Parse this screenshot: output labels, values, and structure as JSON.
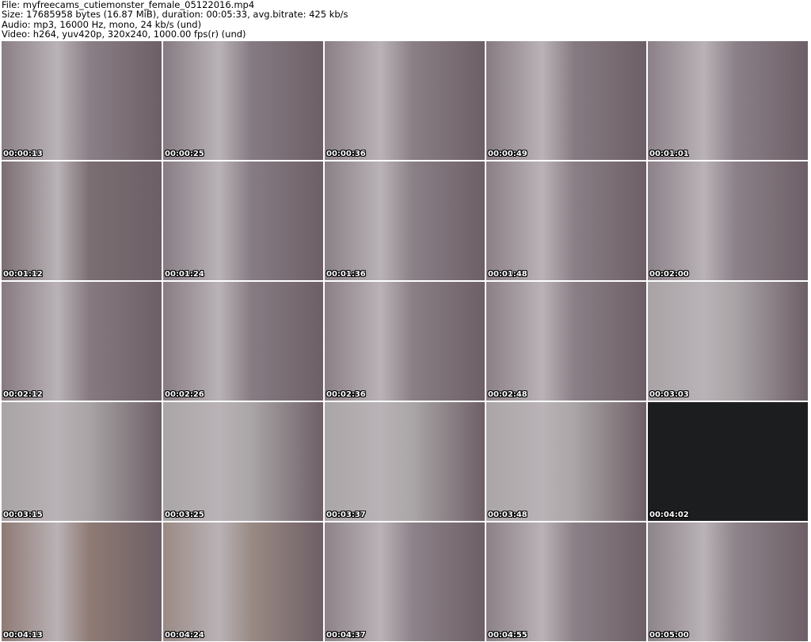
{
  "header": {
    "file": "File: myfreecams_cutiemonster_female_05122016.mp4",
    "size": "Size: 17685958 bytes (16.87 MiB), duration: 00:05:33, avg.bitrate: 425 kb/s",
    "audio": "Audio: mp3, 16000 Hz, mono, 24 kb/s (und)",
    "video": "Video: h264, yuv420p, 320x240, 1000.00 fps(r) (und)"
  },
  "thumbnails": [
    {
      "time": "00:00:13",
      "tone": "#8a7f86"
    },
    {
      "time": "00:00:25",
      "tone": "#867b83"
    },
    {
      "time": "00:00:36",
      "tone": "#8a7f86"
    },
    {
      "time": "00:00:49",
      "tone": "#867b82"
    },
    {
      "time": "00:01:01",
      "tone": "#8b8088"
    },
    {
      "time": "00:01:12",
      "tone": "#7a6e72"
    },
    {
      "time": "00:01:24",
      "tone": "#877c84"
    },
    {
      "time": "00:01:36",
      "tone": "#8a8087"
    },
    {
      "time": "00:01:48",
      "tone": "#8a7f86"
    },
    {
      "time": "00:02:00",
      "tone": "#8c8189"
    },
    {
      "time": "00:02:12",
      "tone": "#867a80"
    },
    {
      "time": "00:02:26",
      "tone": "#877c83"
    },
    {
      "time": "00:02:36",
      "tone": "#8a7f86"
    },
    {
      "time": "00:02:48",
      "tone": "#8a7f86"
    },
    {
      "time": "00:03:03",
      "tone": "#a9a3a6"
    },
    {
      "time": "00:03:15",
      "tone": "#a8a3a4"
    },
    {
      "time": "00:03:25",
      "tone": "#aaa5a6"
    },
    {
      "time": "00:03:37",
      "tone": "#aaa5a6"
    },
    {
      "time": "00:03:48",
      "tone": "#aaa5a6"
    },
    {
      "time": "00:04:02",
      "tone": "#1c1d1e"
    },
    {
      "time": "00:04:13",
      "tone": "#8f7a74"
    },
    {
      "time": "00:04:24",
      "tone": "#9a8a84"
    },
    {
      "time": "00:04:37",
      "tone": "#8d8289"
    },
    {
      "time": "00:04:55",
      "tone": "#8b8087"
    },
    {
      "time": "00:05:00",
      "tone": "#8d838a"
    }
  ]
}
